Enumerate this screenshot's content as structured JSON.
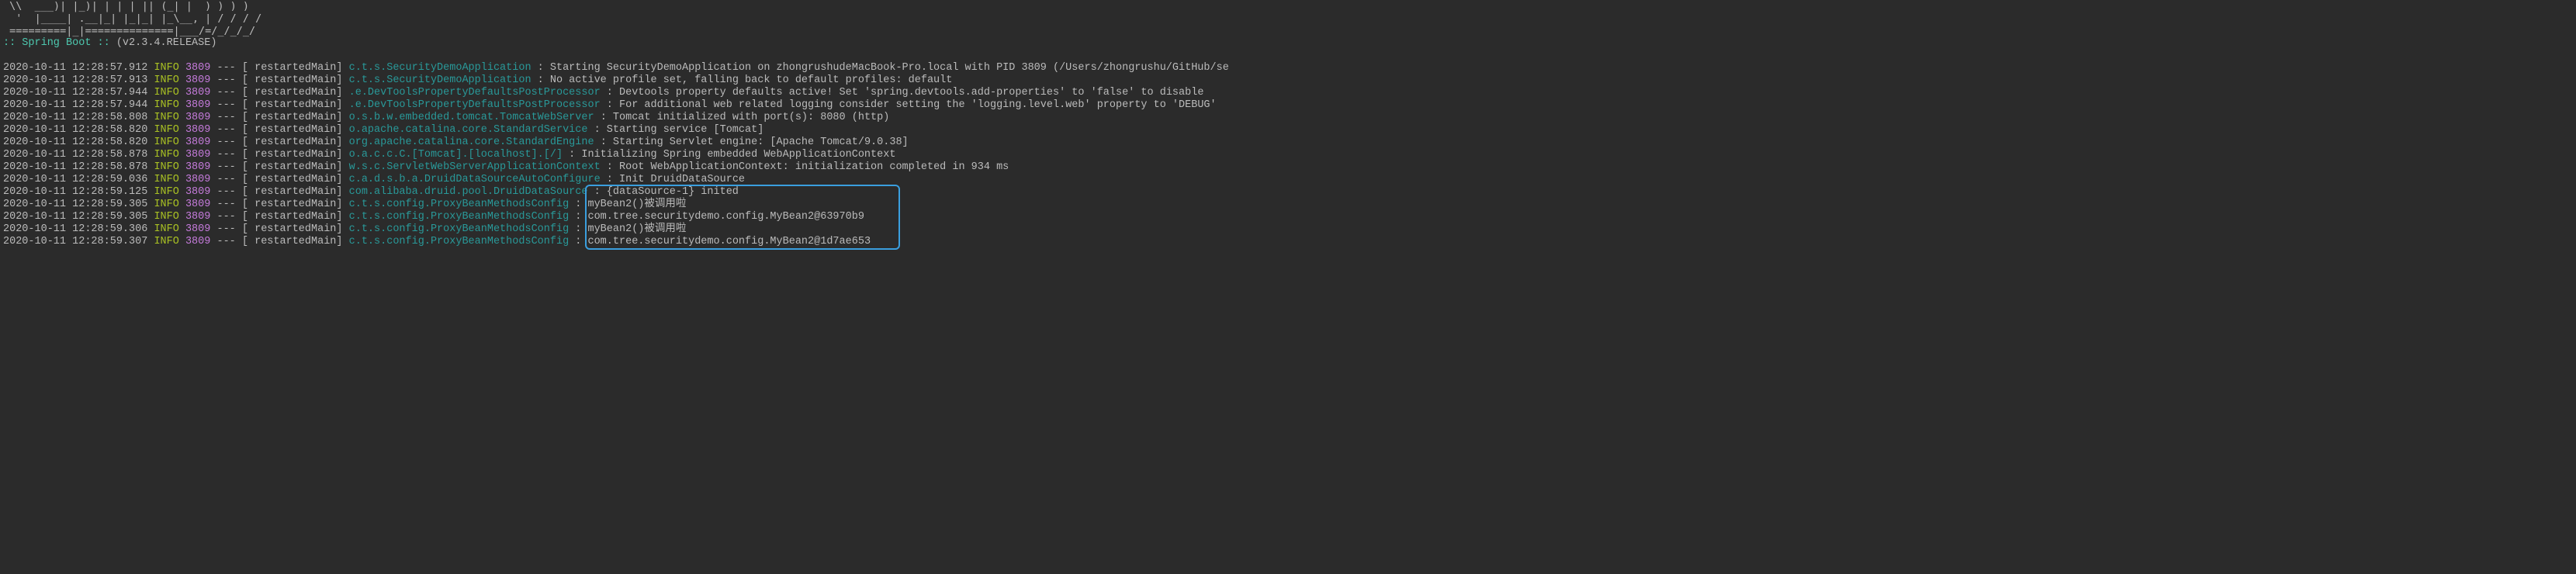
{
  "banner": [
    " \\\\  ___)| |_)| | | | || (_| |  ) ) ) )",
    "  '  |____| .__|_| |_|_| |_\\__, | / / / /",
    " =========|_|==============|___/=/_/_/_/"
  ],
  "boot": {
    "label": " :: Spring Boot :: ",
    "version": "       (v2.3.4.RELEASE)"
  },
  "logs": [
    {
      "ts": "2020-10-11 12:28:57.912",
      "level": "INFO",
      "pid": "3809",
      "dashes": "---",
      "thread": "[   restartedMain]",
      "logger": "c.t.s.SecurityDemoApplication           ",
      "msg": "Starting SecurityDemoApplication on zhongrushudeMacBook-Pro.local with PID 3809 (/Users/zhongrushu/GitHub/se"
    },
    {
      "ts": "2020-10-11 12:28:57.913",
      "level": "INFO",
      "pid": "3809",
      "dashes": "---",
      "thread": "[   restartedMain]",
      "logger": "c.t.s.SecurityDemoApplication           ",
      "msg": "No active profile set, falling back to default profiles: default"
    },
    {
      "ts": "2020-10-11 12:28:57.944",
      "level": "INFO",
      "pid": "3809",
      "dashes": "---",
      "thread": "[   restartedMain]",
      "logger": ".e.DevToolsPropertyDefaultsPostProcessor",
      "msg": "Devtools property defaults active! Set 'spring.devtools.add-properties' to 'false' to disable"
    },
    {
      "ts": "2020-10-11 12:28:57.944",
      "level": "INFO",
      "pid": "3809",
      "dashes": "---",
      "thread": "[   restartedMain]",
      "logger": ".e.DevToolsPropertyDefaultsPostProcessor",
      "msg": "For additional web related logging consider setting the 'logging.level.web' property to 'DEBUG'"
    },
    {
      "ts": "2020-10-11 12:28:58.808",
      "level": "INFO",
      "pid": "3809",
      "dashes": "---",
      "thread": "[   restartedMain]",
      "logger": "o.s.b.w.embedded.tomcat.TomcatWebServer ",
      "msg": "Tomcat initialized with port(s): 8080 (http)"
    },
    {
      "ts": "2020-10-11 12:28:58.820",
      "level": "INFO",
      "pid": "3809",
      "dashes": "---",
      "thread": "[   restartedMain]",
      "logger": "o.apache.catalina.core.StandardService  ",
      "msg": "Starting service [Tomcat]"
    },
    {
      "ts": "2020-10-11 12:28:58.820",
      "level": "INFO",
      "pid": "3809",
      "dashes": "---",
      "thread": "[   restartedMain]",
      "logger": "org.apache.catalina.core.StandardEngine ",
      "msg": "Starting Servlet engine: [Apache Tomcat/9.0.38]"
    },
    {
      "ts": "2020-10-11 12:28:58.878",
      "level": "INFO",
      "pid": "3809",
      "dashes": "---",
      "thread": "[   restartedMain]",
      "logger": "o.a.c.c.C.[Tomcat].[localhost].[/]      ",
      "msg": "Initializing Spring embedded WebApplicationContext"
    },
    {
      "ts": "2020-10-11 12:28:58.878",
      "level": "INFO",
      "pid": "3809",
      "dashes": "---",
      "thread": "[   restartedMain]",
      "logger": "w.s.c.ServletWebServerApplicationContext",
      "msg": "Root WebApplicationContext: initialization completed in 934 ms"
    },
    {
      "ts": "2020-10-11 12:28:59.036",
      "level": "INFO",
      "pid": "3809",
      "dashes": "---",
      "thread": "[   restartedMain]",
      "logger": "c.a.d.s.b.a.DruidDataSourceAutoConfigure",
      "msg": "Init DruidDataSource"
    },
    {
      "ts": "2020-10-11 12:28:59.125",
      "level": "INFO",
      "pid": "3809",
      "dashes": "---",
      "thread": "[   restartedMain]",
      "logger": "com.alibaba.druid.pool.DruidDataSource  ",
      "msg": "{dataSource-1} inited"
    },
    {
      "ts": "2020-10-11 12:28:59.305",
      "level": "INFO",
      "pid": "3809",
      "dashes": "---",
      "thread": "[   restartedMain]",
      "logger": "c.t.s.config.ProxyBeanMethodsConfig     ",
      "msg": "myBean2()被调用啦"
    },
    {
      "ts": "2020-10-11 12:28:59.305",
      "level": "INFO",
      "pid": "3809",
      "dashes": "---",
      "thread": "[   restartedMain]",
      "logger": "c.t.s.config.ProxyBeanMethodsConfig     ",
      "msg": "com.tree.securitydemo.config.MyBean2@63970b9"
    },
    {
      "ts": "2020-10-11 12:28:59.306",
      "level": "INFO",
      "pid": "3809",
      "dashes": "---",
      "thread": "[   restartedMain]",
      "logger": "c.t.s.config.ProxyBeanMethodsConfig     ",
      "msg": "myBean2()被调用啦"
    },
    {
      "ts": "2020-10-11 12:28:59.307",
      "level": "INFO",
      "pid": "3809",
      "dashes": "---",
      "thread": "[   restartedMain]",
      "logger": "c.t.s.config.ProxyBeanMethodsConfig     ",
      "msg": "com.tree.securitydemo.config.MyBean2@1d7ae653"
    }
  ],
  "highlight": {
    "top_row": 10,
    "bottom_row": 14,
    "msg_col_char": 93,
    "width_chars": 50
  }
}
